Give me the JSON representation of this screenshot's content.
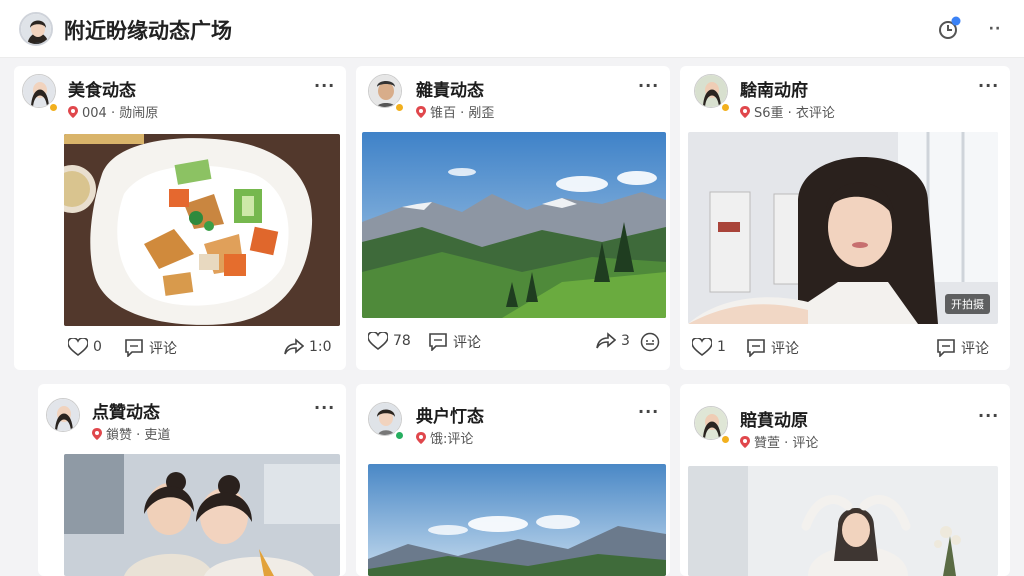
{
  "header": {
    "title": "附近盼缘动态广场",
    "icons": [
      "avatar",
      "clock-notification-icon",
      "more-icon"
    ]
  },
  "cards": [
    {
      "title": "美食动态",
      "meta": "004 · 勋闹原",
      "likes": "0",
      "comment_label": "评论",
      "shares": "1:0",
      "dot": "#f2b01e"
    },
    {
      "title": "雜責动态",
      "meta": "锥百 · 剐歪",
      "likes": "78",
      "comment_label": "评论",
      "shares": "3",
      "dot": "#f2b01e"
    },
    {
      "title": "騇南动府",
      "meta": "S6重 · 衣评论",
      "likes": "1",
      "comment_label": "评论",
      "comment_label2": "评论",
      "dot": "#f2b01e",
      "overlay": "开拍摄"
    },
    {
      "title": "点贊动态",
      "meta": "鎖赞 · 吏道",
      "dot": null
    },
    {
      "title": "典户忊态",
      "meta": "饿:评论",
      "dot": "#27ae60"
    },
    {
      "title": "賠賁动原",
      "meta": "贊萱 · 评论",
      "dot": "#f2b01e"
    }
  ]
}
